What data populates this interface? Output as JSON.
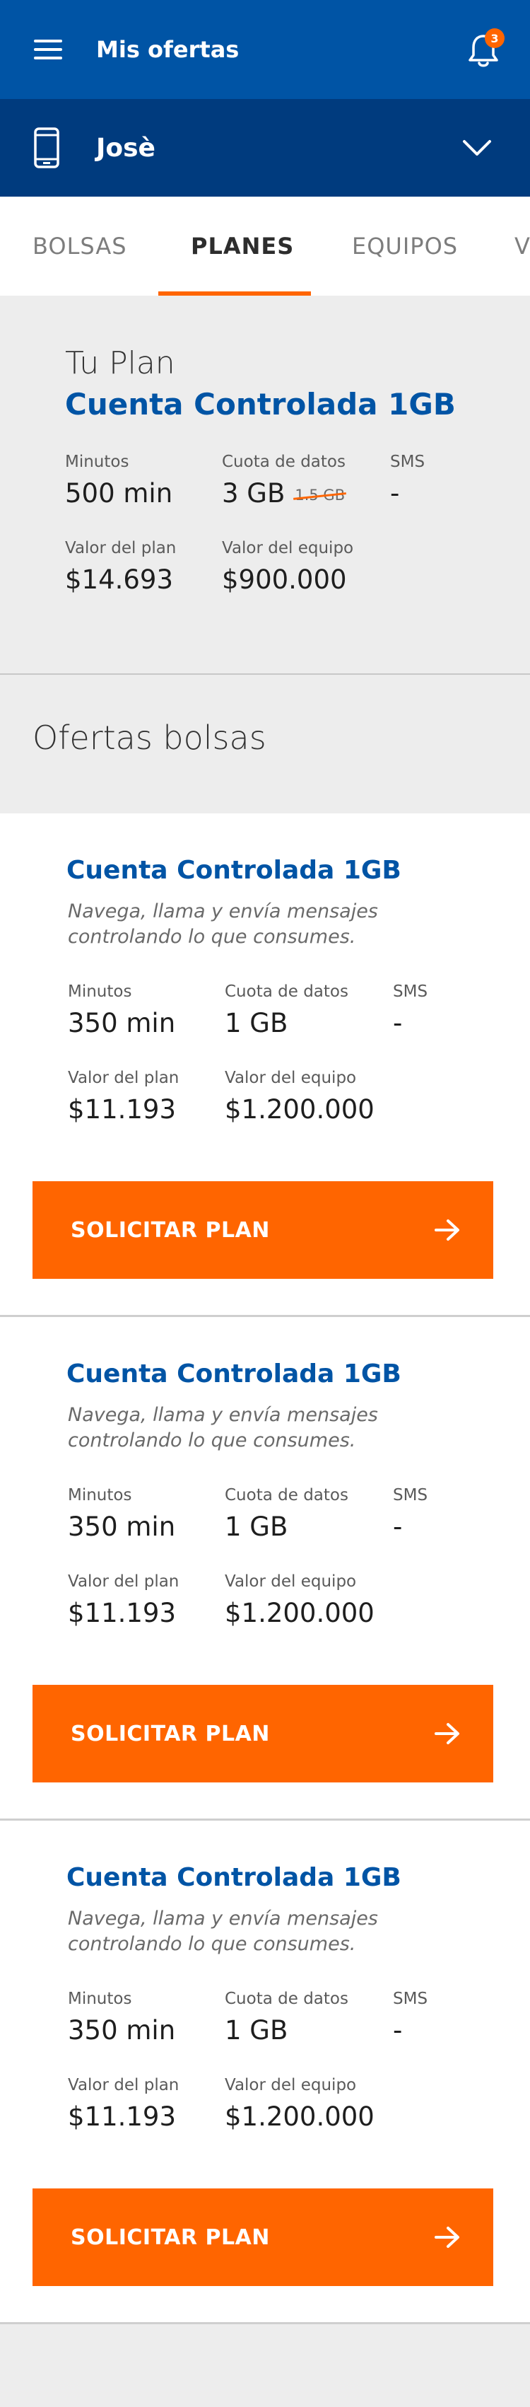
{
  "header": {
    "title": "Mis ofertas",
    "notification_count": "3"
  },
  "line_selector": {
    "name": "Josè"
  },
  "tabs": [
    {
      "label": "BOLSAS",
      "active": false
    },
    {
      "label": "PLANES",
      "active": true
    },
    {
      "label": "EQUIPOS",
      "active": false
    },
    {
      "label": "V",
      "active": false
    }
  ],
  "current_plan": {
    "heading": "Tu Plan",
    "name": "Cuenta Controlada 1GB",
    "minutes_label": "Minutos",
    "minutes_value": "500 min",
    "data_label": "Cuota de datos",
    "data_value": "3 GB",
    "data_old_value": "1.5 GB",
    "sms_label": "SMS",
    "sms_value": "-",
    "plan_price_label": "Valor del plan",
    "plan_price_value": "$14.693",
    "device_price_label": "Valor del equipo",
    "device_price_value": "$900.000"
  },
  "offers_section": {
    "title": "Ofertas bolsas"
  },
  "offers": [
    {
      "title": "Cuenta Controlada 1GB",
      "description": "Navega, llama y envía mensajes controlando lo que consumes.",
      "minutes_label": "Minutos",
      "minutes_value": "350 min",
      "data_label": "Cuota de datos",
      "data_value": "1 GB",
      "sms_label": "SMS",
      "sms_value": "-",
      "plan_price_label": "Valor del plan",
      "plan_price_value": "$11.193",
      "device_price_label": "Valor del equipo",
      "device_price_value": "$1.200.000",
      "cta_label": "SOLICITAR PLAN"
    },
    {
      "title": "Cuenta Controlada 1GB",
      "description": "Navega, llama y envía mensajes controlando lo que consumes.",
      "minutes_label": "Minutos",
      "minutes_value": "350 min",
      "data_label": "Cuota de datos",
      "data_value": "1 GB",
      "sms_label": "SMS",
      "sms_value": "-",
      "plan_price_label": "Valor del plan",
      "plan_price_value": "$11.193",
      "device_price_label": "Valor del equipo",
      "device_price_value": "$1.200.000",
      "cta_label": "SOLICITAR PLAN"
    },
    {
      "title": "Cuenta Controlada 1GB",
      "description": "Navega, llama y envía mensajes controlando lo que consumes.",
      "minutes_label": "Minutos",
      "minutes_value": "350 min",
      "data_label": "Cuota de datos",
      "data_value": "1 GB",
      "sms_label": "SMS",
      "sms_value": "-",
      "plan_price_label": "Valor del plan",
      "plan_price_value": "$11.193",
      "device_price_label": "Valor del equipo",
      "device_price_value": "$1.200.000",
      "cta_label": "SOLICITAR PLAN"
    }
  ],
  "icons": {
    "menu": "hamburger-menu-icon",
    "notifications": "bell-icon",
    "line": "smartphone-icon",
    "expand": "chevron-down-icon",
    "cta": "arrow-right-icon"
  },
  "colors": {
    "primary": "#0054a5",
    "primary_dark": "#003b7e",
    "accent": "#ff6500",
    "background": "#ededed"
  }
}
